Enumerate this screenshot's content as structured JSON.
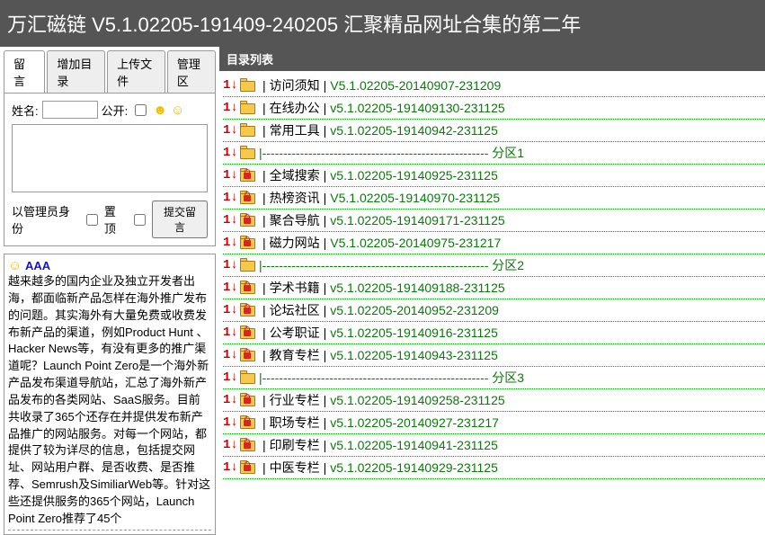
{
  "header": {
    "title": "万汇磁链 V5.1.02205-191409-240205 汇聚精品网址合集的第二年"
  },
  "tabs": [
    "留 言",
    "增加目录",
    "上传文件",
    "管理区"
  ],
  "form": {
    "name_label": "姓名:",
    "public_label": "公开:",
    "admin_label": "以管理员身份",
    "pin_label": "置顶",
    "submit_label": "提交留言"
  },
  "message": {
    "author": "AAA",
    "body": "越来越多的国内企业及独立开发者出海，都面临新产品怎样在海外推广发布的问题。其实海外有大量免费或收费发布新产品的渠道，例如Product Hunt 、Hacker News等，有没有更多的推广渠道呢？Launch Point Zero是一个海外新产品发布渠道导航站，汇总了海外新产品发布的各类网站、SaaS服务。目前共收录了365个还存在并提供发布新产品推广的网站服务。对每一个网站，都提供了较为详尽的信息，包括提交网址、网站用户群、是否收费、是否推荐、Semrush及SimiliarWeb等。针对这些还提供服务的365个网站，Launch Point Zero推荐了45个"
  },
  "dir_header": "目录列表",
  "sep_dash": "|------------------------------------------------------",
  "items": [
    {
      "locked": false,
      "name": "访问须知",
      "ver": "V5.1.02205-20140907-231209"
    },
    {
      "locked": false,
      "name": "在线办公",
      "ver": "v5.1.02205-191409130-231125"
    },
    {
      "locked": false,
      "name": "常用工具",
      "ver": "v5.1.02205-19140942-231125"
    },
    {
      "sep": true,
      "label": "分区1"
    },
    {
      "locked": true,
      "name": "全域搜索",
      "ver": "v5.1.02205-19140925-231125"
    },
    {
      "locked": true,
      "name": "热榜资讯",
      "ver": "V5.1.02205-19140970-231125"
    },
    {
      "locked": true,
      "name": "聚合导航",
      "ver": "v5.1.02205-191409171-231125"
    },
    {
      "locked": true,
      "name": "磁力网站",
      "ver": "V5.1.02205-20140975-231217"
    },
    {
      "sep": true,
      "label": "分区2"
    },
    {
      "locked": true,
      "name": "学术书籍",
      "ver": "v5.1.02205-191409188-231125"
    },
    {
      "locked": true,
      "name": "论坛社区",
      "ver": "v5.1.02205-20140952-231209"
    },
    {
      "locked": true,
      "name": "公考职证",
      "ver": "v5.1.02205-19140916-231125"
    },
    {
      "locked": true,
      "name": "教育专栏",
      "ver": "v5.1.02205-19140943-231125"
    },
    {
      "sep": true,
      "label": "分区3"
    },
    {
      "locked": true,
      "name": "行业专栏",
      "ver": "v5.1.02205-191409258-231125"
    },
    {
      "locked": true,
      "name": "职场专栏",
      "ver": "v5.1.02205-20140927-231217"
    },
    {
      "locked": true,
      "name": "印刷专栏",
      "ver": "v5.1.02205-19140941-231125"
    },
    {
      "locked": true,
      "name": "中医专栏",
      "ver": "v5.1.02205-19140929-231125"
    }
  ]
}
